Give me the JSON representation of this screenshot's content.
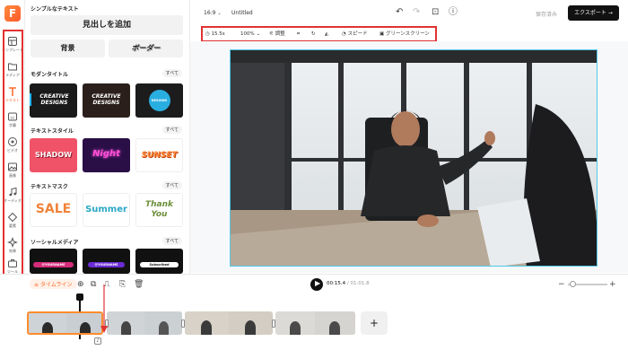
{
  "rail": {
    "items": [
      {
        "label": "テンプレート",
        "icon": "template-icon"
      },
      {
        "label": "メディア",
        "icon": "media-icon"
      },
      {
        "label": "テキスト",
        "icon": "text-icon"
      },
      {
        "label": "字幕",
        "icon": "subtitle-icon"
      },
      {
        "label": "ビデオ",
        "icon": "video-icon"
      },
      {
        "label": "画像",
        "icon": "image-icon"
      },
      {
        "label": "オーディオ",
        "icon": "audio-icon"
      },
      {
        "label": "要素",
        "icon": "elements-icon"
      },
      {
        "label": "効果",
        "icon": "effects-icon"
      },
      {
        "label": "ツール",
        "icon": "tools-icon"
      }
    ]
  },
  "panel": {
    "simple_text": "シンプルなテキスト",
    "add_heading": "見出しを追加",
    "background": "背景",
    "border": "ボーダー",
    "see_all": "すべて",
    "modern_title": "モダンタイトル",
    "modern_thumbs": [
      "CREATIVE DESIGNS",
      "CREATIVE DESIGNS",
      "DESIGNS"
    ],
    "text_style": "テキストスタイル",
    "style_thumbs": [
      "SHADOW",
      "Night",
      "SUNSET"
    ],
    "text_mask": "テキストマスク",
    "mask_thumbs": [
      "SALE",
      "Summer",
      "Thank You"
    ],
    "social_media": "ソーシャルメディア",
    "social_thumbs": [
      "@YOURNAME",
      "@YOURNAME",
      "Subscribed"
    ]
  },
  "topbar": {
    "aspect": "16:9",
    "title": "Untitled",
    "saved": "保存済み",
    "export": "エクスポート"
  },
  "toolbar": {
    "duration": "15.5s",
    "zoom": "100%",
    "crop": "調整",
    "speed": "スピード",
    "green_screen": "グリーンスクリーン"
  },
  "timeline": {
    "label": "タイムライン",
    "current_time": "00:15.4",
    "total_time": "01:01.8",
    "add": "+"
  },
  "colors": {
    "accent": "#ff6b2c",
    "annotation": "#e23232",
    "selection": "#ff8c2e",
    "canvas_border": "#52c7e8"
  }
}
